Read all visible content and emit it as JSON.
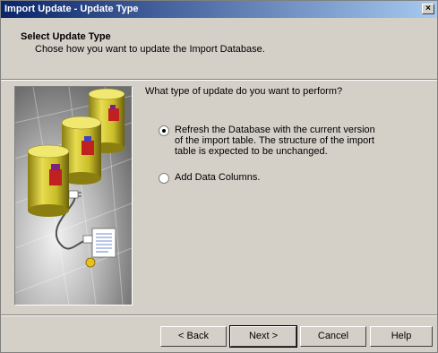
{
  "window": {
    "title": "Import Update - Update Type",
    "close_glyph": "×"
  },
  "header": {
    "title": "Select Update Type",
    "subtitle": "Chose how you want to update the Import Database."
  },
  "main": {
    "question": "What type of update do you want to perform?",
    "options": [
      {
        "label": "Refresh the Database with the current version of the import table.  The structure of the import table is expected to be unchanged.",
        "selected": true
      },
      {
        "label": "Add Data Columns.",
        "selected": false
      }
    ]
  },
  "buttons": {
    "back": "< Back",
    "next": "Next >",
    "cancel": "Cancel",
    "help": "Help"
  },
  "colors": {
    "titlebar_start": "#0a246a",
    "titlebar_end": "#a6caf0",
    "dialog_bg": "#d4d0c8",
    "cylinder": "#d8cc30"
  }
}
